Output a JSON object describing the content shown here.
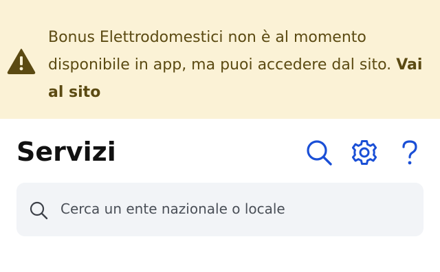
{
  "banner": {
    "message": "Bonus Elettrodomestici non è al momento disponibile in app, ma puoi accedere dal sito.",
    "link_label": "Vai al sito",
    "icon": "warning-icon",
    "background_color": "#fbf2d6",
    "text_color": "#5b4a12"
  },
  "header": {
    "title": "Servizi",
    "actions": [
      {
        "icon": "search-icon"
      },
      {
        "icon": "gear-icon"
      },
      {
        "icon": "help-icon"
      }
    ],
    "accent_color": "#1a4fd6"
  },
  "search": {
    "placeholder": "Cerca un ente nazionale o locale",
    "value": "",
    "icon": "search-icon"
  }
}
